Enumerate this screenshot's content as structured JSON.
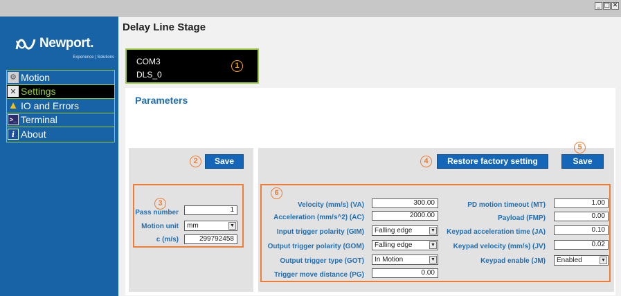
{
  "window": {
    "minimize": "_",
    "maximize": "□",
    "close": "✕"
  },
  "brand": {
    "name": "Newport.",
    "tagline": "Experience | Solutions"
  },
  "sidebar": {
    "items": [
      {
        "label": "Motion",
        "icon": "gear-icon",
        "active": false
      },
      {
        "label": "Settings",
        "icon": "tools-icon",
        "active": true
      },
      {
        "label": "IO and Errors",
        "icon": "warning-icon",
        "active": false
      },
      {
        "label": "Terminal",
        "icon": "terminal-icon",
        "active": false
      },
      {
        "label": "About",
        "icon": "info-icon",
        "active": false
      }
    ]
  },
  "page": {
    "title": "Delay Line Stage"
  },
  "connection": {
    "port": "COM3",
    "device": "DLS_0"
  },
  "callouts": [
    "1",
    "2",
    "3",
    "4",
    "5",
    "6"
  ],
  "parameters": {
    "title": "Parameters",
    "save_label": "Save",
    "restore_label": "Restore factory setting",
    "save2_label": "Save"
  },
  "left_fields": {
    "pass_number": {
      "label": "Pass number",
      "value": "1"
    },
    "motion_unit": {
      "label": "Motion unit",
      "value": "mm"
    },
    "c": {
      "label": "c (m/s)",
      "value": "299792458"
    }
  },
  "right_fields": {
    "velocity": {
      "label": "Velocity (mm/s) (VA)",
      "value": "300.00"
    },
    "acceleration": {
      "label": "Acceleration (mm/s^2) (AC)",
      "value": "2000.00"
    },
    "input_trigger": {
      "label": "Input trigger polarity (GIM)",
      "value": "Falling edge"
    },
    "output_trigger": {
      "label": "Output trigger polarity (GOM)",
      "value": "Falling edge"
    },
    "output_type": {
      "label": "Output trigger type (GOT)",
      "value": "In Motion"
    },
    "trigger_distance": {
      "label": "Trigger move distance (PG)",
      "value": "0.00"
    },
    "pd_timeout": {
      "label": "PD motion timeout (MT)",
      "value": "1.00"
    },
    "payload": {
      "label": "Payload (FMP)",
      "value": "0.00"
    },
    "keypad_accel": {
      "label": "Keypad acceleration time (JA)",
      "value": "0.10"
    },
    "keypad_velocity": {
      "label": "Keypad velocity (mm/s) (JV)",
      "value": "0.02"
    },
    "keypad_enable": {
      "label": "Keypad enable (JM)",
      "value": "Enabled"
    }
  },
  "colors": {
    "sidebar_bg": "#1763a6",
    "accent_green": "#9acd32",
    "accent_orange": "#ef7d31",
    "button_blue": "#1466b8",
    "label_blue": "#1e6fb4"
  }
}
